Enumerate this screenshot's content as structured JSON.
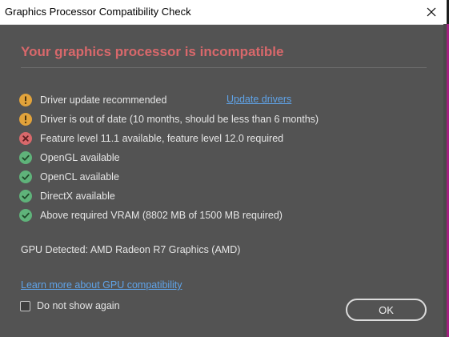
{
  "window": {
    "title": "Graphics Processor Compatibility Check"
  },
  "heading": "Your graphics processor is incompatible",
  "checks": [
    {
      "status": "warning",
      "icon": "warning-icon",
      "label": "Driver update recommended"
    },
    {
      "status": "warning",
      "icon": "warning-icon",
      "label": "Driver is out of date (10 months, should be less than 6 months)"
    },
    {
      "status": "error",
      "icon": "error-icon",
      "label": "Feature level 11.1 available, feature level 12.0 required"
    },
    {
      "status": "ok",
      "icon": "check-icon",
      "label": "OpenGL available"
    },
    {
      "status": "ok",
      "icon": "check-icon",
      "label": "OpenCL available"
    },
    {
      "status": "ok",
      "icon": "check-icon",
      "label": "DirectX available"
    },
    {
      "status": "ok",
      "icon": "check-icon",
      "label": "Above required VRAM (8802 MB of 1500 MB required)"
    }
  ],
  "update_link": "Update drivers",
  "gpu_detected": "GPU Detected: AMD Radeon R7 Graphics (AMD)",
  "learn_more_link": "Learn more about GPU compatibility",
  "dont_show": {
    "label": "Do not show again",
    "checked": false
  },
  "ok_button": "OK",
  "colors": {
    "warning": "#e2a33b",
    "error": "#d9686b",
    "ok": "#5fb37a",
    "link": "#5fa3e8",
    "heading": "#d9686b",
    "background": "#535353",
    "accent": "#a32080"
  }
}
